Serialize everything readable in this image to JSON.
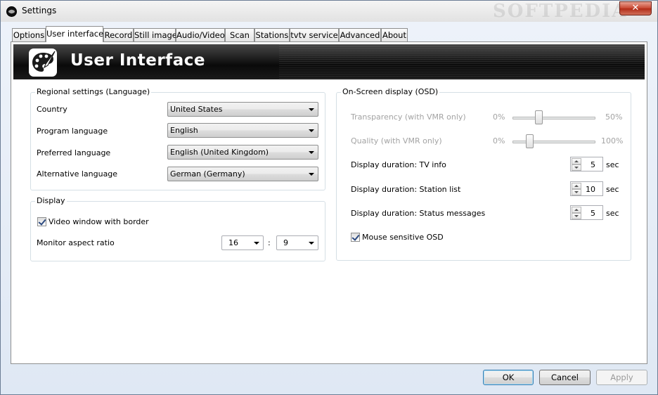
{
  "window": {
    "title": "Settings",
    "close_symbol": "✕"
  },
  "watermark": "SOFTPEDIA",
  "tabs": [
    {
      "label": "Options"
    },
    {
      "label": "User interface",
      "active": true
    },
    {
      "label": "Record"
    },
    {
      "label": "Still image"
    },
    {
      "label": "Audio/Video"
    },
    {
      "label": "Scan"
    },
    {
      "label": "Stations"
    },
    {
      "label": "tvtv service"
    },
    {
      "label": "Advanced"
    },
    {
      "label": "About"
    }
  ],
  "banner": {
    "title": "User Interface",
    "icon": "palette-icon"
  },
  "regional": {
    "title": "Regional settings (Language)",
    "rows": [
      {
        "label": "Country",
        "value": "United States"
      },
      {
        "label": "Program language",
        "value": "English"
      },
      {
        "label": "Preferred language",
        "value": "English (United Kingdom)"
      },
      {
        "label": "Alternative language",
        "value": "German (Germany)"
      }
    ]
  },
  "display": {
    "title": "Display",
    "video_border_label": "Video window with border",
    "video_border_checked": true,
    "aspect_label": "Monitor aspect ratio",
    "aspect_w": "16",
    "aspect_sep": ":",
    "aspect_h": "9"
  },
  "osd": {
    "title": "On-Screen display (OSD)",
    "transparency": {
      "label": "Transparency (with VMR only)",
      "min": "0%",
      "max": "50%",
      "value_fraction": 0.3
    },
    "quality": {
      "label": "Quality (with VMR only)",
      "min": "0%",
      "max": "100%",
      "value_fraction": 0.18
    },
    "durations": [
      {
        "label": "Display duration: TV info",
        "value": "5",
        "unit": "sec"
      },
      {
        "label": "Display duration: Station list",
        "value": "10",
        "unit": "sec"
      },
      {
        "label": "Display duration: Status messages",
        "value": "5",
        "unit": "sec"
      }
    ],
    "mouse_label": "Mouse sensitive OSD",
    "mouse_checked": true
  },
  "buttons": {
    "ok": "OK",
    "cancel": "Cancel",
    "apply": "Apply"
  }
}
